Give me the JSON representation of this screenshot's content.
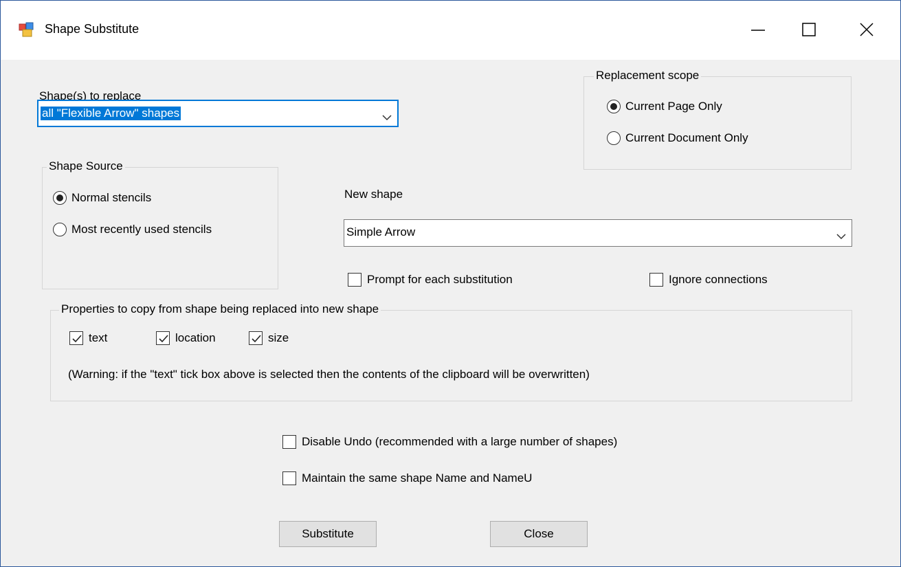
{
  "window": {
    "title": "Shape Substitute"
  },
  "shapes_to_replace": {
    "label": "Shape(s) to replace",
    "value": "all \"Flexible Arrow\" shapes"
  },
  "replacement_scope": {
    "legend": "Replacement scope",
    "options": [
      "Current Page Only",
      "Current Document Only"
    ],
    "selected": "Current Page Only"
  },
  "shape_source": {
    "legend": "Shape  Source",
    "options": [
      "Normal stencils",
      "Most recently used stencils"
    ],
    "selected": "Normal stencils"
  },
  "new_shape": {
    "label": "New shape",
    "value": "Simple Arrow"
  },
  "options": {
    "prompt_each": {
      "label": "Prompt for each substitution",
      "checked": false
    },
    "ignore_connections": {
      "label": "Ignore connections",
      "checked": false
    }
  },
  "properties": {
    "legend": "Properties to copy from shape being replaced into new shape",
    "text": {
      "label": "text",
      "checked": true
    },
    "location": {
      "label": "location",
      "checked": true
    },
    "size": {
      "label": "size",
      "checked": true
    },
    "warning": "(Warning: if the \"text\" tick box above is selected then the contents of the clipboard will be overwritten)"
  },
  "disable_undo": {
    "label": "Disable Undo (recommended with a large number of shapes)",
    "checked": false
  },
  "maintain_name": {
    "label": "Maintain the same shape Name and NameU",
    "checked": false
  },
  "buttons": {
    "substitute": "Substitute",
    "close": "Close"
  },
  "colors": {
    "accent": "#0078d7",
    "window_bg": "#f0f0f0"
  }
}
